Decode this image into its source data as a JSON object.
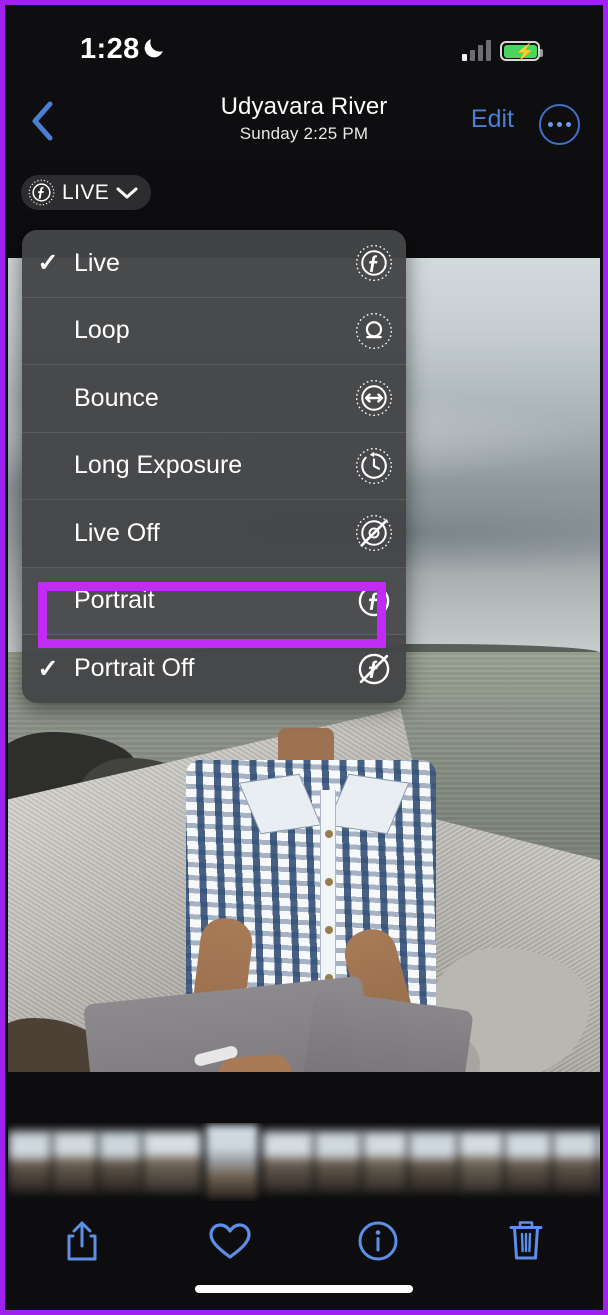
{
  "app": "iOS Photos",
  "status_bar": {
    "time": "1:28",
    "dnd_icon": "crescent-moon-icon",
    "signal_icon": "cellular-bars-icon",
    "signal_bars_filled": 1,
    "signal_bars_total": 4,
    "battery_icon": "battery-charging-icon",
    "battery_color": "#4cd55c",
    "battery_charging": true
  },
  "nav_bar": {
    "back_icon": "chevron-left-icon",
    "title": "Udyavara River",
    "subtitle": "Sunday  2:25 PM",
    "edit_label": "Edit",
    "edit_color": "#4a7fd4",
    "more_icon": "ellipsis-circle-icon"
  },
  "live_badge": {
    "icon": "live-photo-icon",
    "label": "LIVE",
    "chevron_icon": "chevron-down-icon"
  },
  "live_menu": {
    "items": [
      {
        "label": "Live",
        "icon": "live-photo-icon",
        "checked": true,
        "highlighted": false
      },
      {
        "label": "Loop",
        "icon": "loop-icon",
        "checked": false,
        "highlighted": false
      },
      {
        "label": "Bounce",
        "icon": "bounce-icon",
        "checked": false,
        "highlighted": false
      },
      {
        "label": "Long Exposure",
        "icon": "long-exposure-icon",
        "checked": false,
        "highlighted": false
      },
      {
        "label": "Live Off",
        "icon": "live-photo-off-icon",
        "checked": false,
        "highlighted": false
      },
      {
        "label": "Portrait",
        "icon": "portrait-icon",
        "checked": false,
        "highlighted": true
      },
      {
        "label": "Portrait Off",
        "icon": "portrait-off-icon",
        "checked": true,
        "highlighted": false
      }
    ],
    "highlight_color": "#c02bf5",
    "check_glyph": "✓"
  },
  "photo": {
    "description": "Person in blue and white tie-dye shirt and grey shorts sitting on a concrete ledge beside rocks and river water under an overcast grey sky"
  },
  "filmstrip": {
    "selected_index": 4,
    "thumb_count": 13
  },
  "toolbar": {
    "items": [
      {
        "name": "share-button",
        "icon": "share-icon"
      },
      {
        "name": "favorite-button",
        "icon": "heart-icon"
      },
      {
        "name": "info-button",
        "icon": "info-circle-icon"
      },
      {
        "name": "delete-button",
        "icon": "trash-icon"
      }
    ],
    "tint_color": "#5d8fe8"
  },
  "frame": {
    "border_color": "#a021ef"
  }
}
